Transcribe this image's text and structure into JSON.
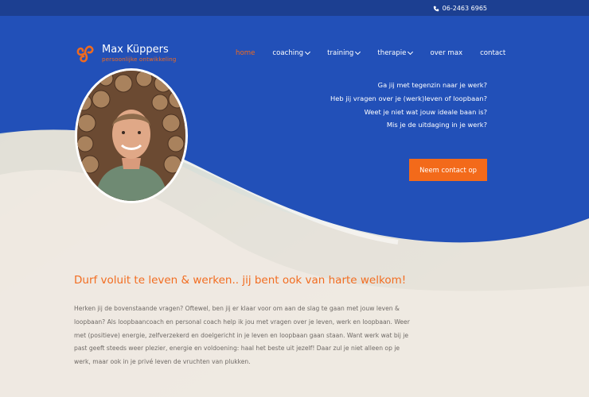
{
  "topbar": {
    "phone": "06-2463 6965",
    "phone_icon": "phone-icon"
  },
  "logo": {
    "name": "Max Küppers",
    "tagline": "persoonlijke ontwikkeling",
    "icon": "triskelion-icon"
  },
  "nav": {
    "home": "home",
    "coaching": "coaching",
    "training": "training",
    "therapie": "therapie",
    "over_max": "over max",
    "contact": "contact"
  },
  "hero": {
    "questions": [
      "Ga jij met tegenzin naar je werk?",
      "Heb jij vragen over je (werk)leven of loopbaan?",
      "Weet je niet wat jouw ideale baan is?",
      "Mis je de uitdaging in je werk?"
    ],
    "cta_label": "Neem contact op"
  },
  "content": {
    "headline": "Durf voluit te leven & werken.. jij bent ook van harte welkom!",
    "body": "Herken jij de bovenstaande vragen? Oftewel, ben jij er klaar voor om aan de slag te gaan met jouw leven & loopbaan? Als loopbaancoach en personal coach help ik jou met vragen over je leven, werk en loopbaan. Weer met (positieve) energie, zelfverzekerd en doelgericht in je leven en loopbaan gaan staan. Want werk wat bij je past geeft steeds weer plezier, energie en voldoening: haal het beste uit jezelf! Daar zul je niet alleen op je werk, maar ook in je privé leven de vruchten van plukken."
  },
  "colors": {
    "blue": "#2250b8",
    "dark_blue": "#1c3f91",
    "orange": "#f36a1a",
    "sand": "#eee9e1"
  }
}
